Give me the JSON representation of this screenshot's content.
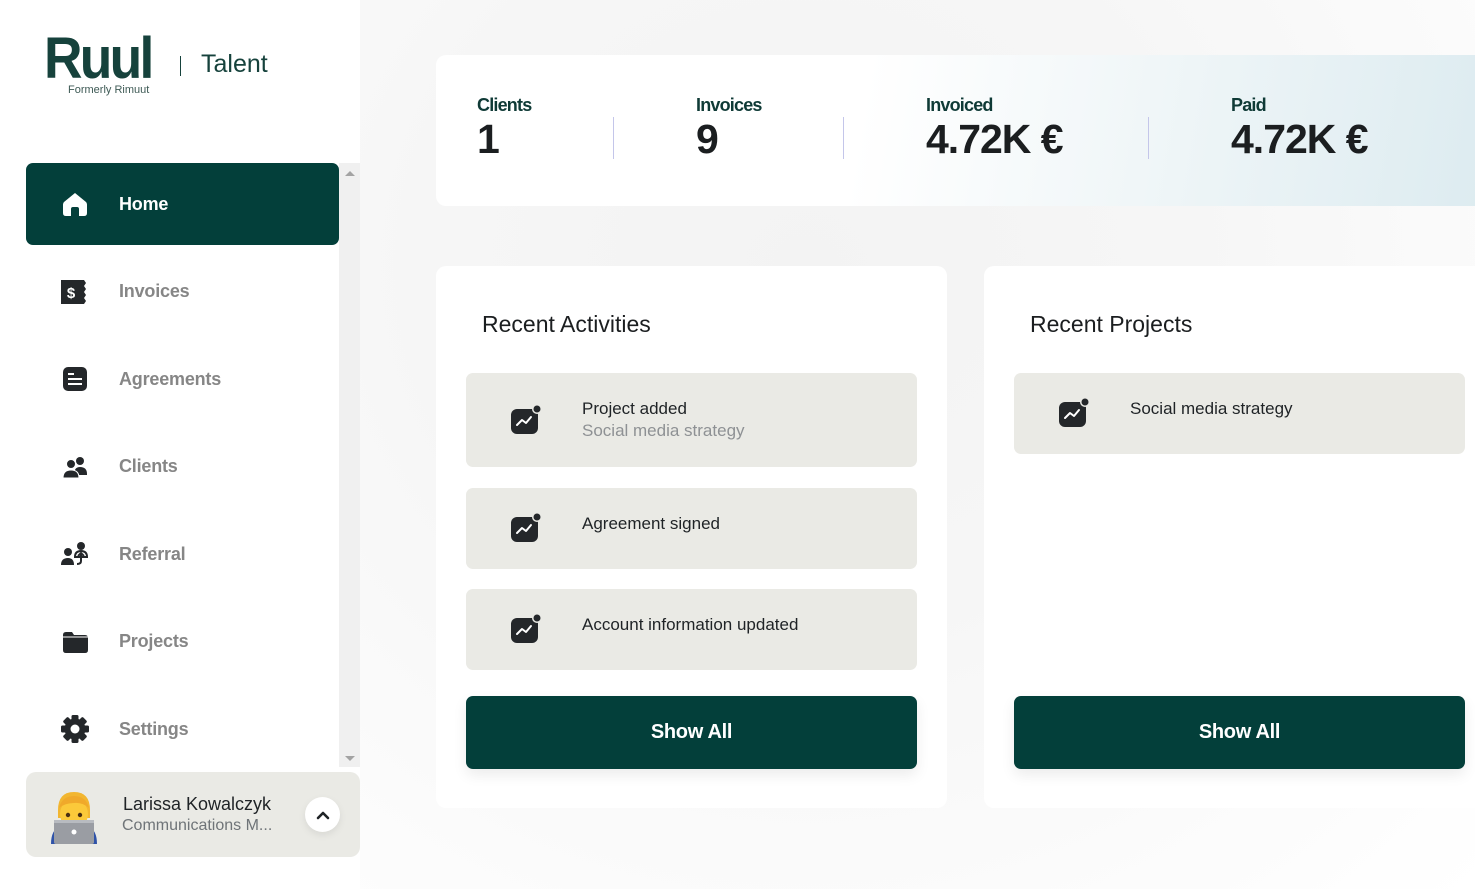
{
  "brand": {
    "logo": "Ruul",
    "tagline": "Formerly Rimuut",
    "product": "Talent"
  },
  "colors": {
    "primary": "#033f3a",
    "card_item_bg": "#eaeae5",
    "nav_inactive_text": "#868686"
  },
  "sidebar": {
    "items": [
      {
        "label": "Home",
        "icon": "home-icon",
        "active": true
      },
      {
        "label": "Invoices",
        "icon": "invoice-icon",
        "active": false
      },
      {
        "label": "Agreements",
        "icon": "document-icon",
        "active": false
      },
      {
        "label": "Clients",
        "icon": "users-icon",
        "active": false
      },
      {
        "label": "Referral",
        "icon": "referral-icon",
        "active": false
      },
      {
        "label": "Projects",
        "icon": "folder-icon",
        "active": false
      },
      {
        "label": "Settings",
        "icon": "gear-icon",
        "active": false
      }
    ],
    "user": {
      "name": "Larissa Kowalczyk",
      "role": "Communications M...",
      "avatar": "technologist-emoji"
    }
  },
  "stats": [
    {
      "label": "Clients",
      "value": "1"
    },
    {
      "label": "Invoices",
      "value": "9"
    },
    {
      "label": "Invoiced",
      "value": "4.72K €"
    },
    {
      "label": "Paid",
      "value": "4.72K €"
    }
  ],
  "recent_activities": {
    "title": "Recent Activities",
    "items": [
      {
        "title": "Project added",
        "subtitle": "Social media strategy",
        "icon": "activity-chart-icon"
      },
      {
        "title": "Agreement signed",
        "subtitle": "",
        "icon": "activity-chart-icon"
      },
      {
        "title": "Account information updated",
        "subtitle": "",
        "icon": "activity-chart-icon"
      }
    ],
    "show_all_label": "Show All"
  },
  "recent_projects": {
    "title": "Recent Projects",
    "items": [
      {
        "title": "Social media strategy",
        "icon": "activity-chart-icon"
      }
    ],
    "show_all_label": "Show All"
  }
}
